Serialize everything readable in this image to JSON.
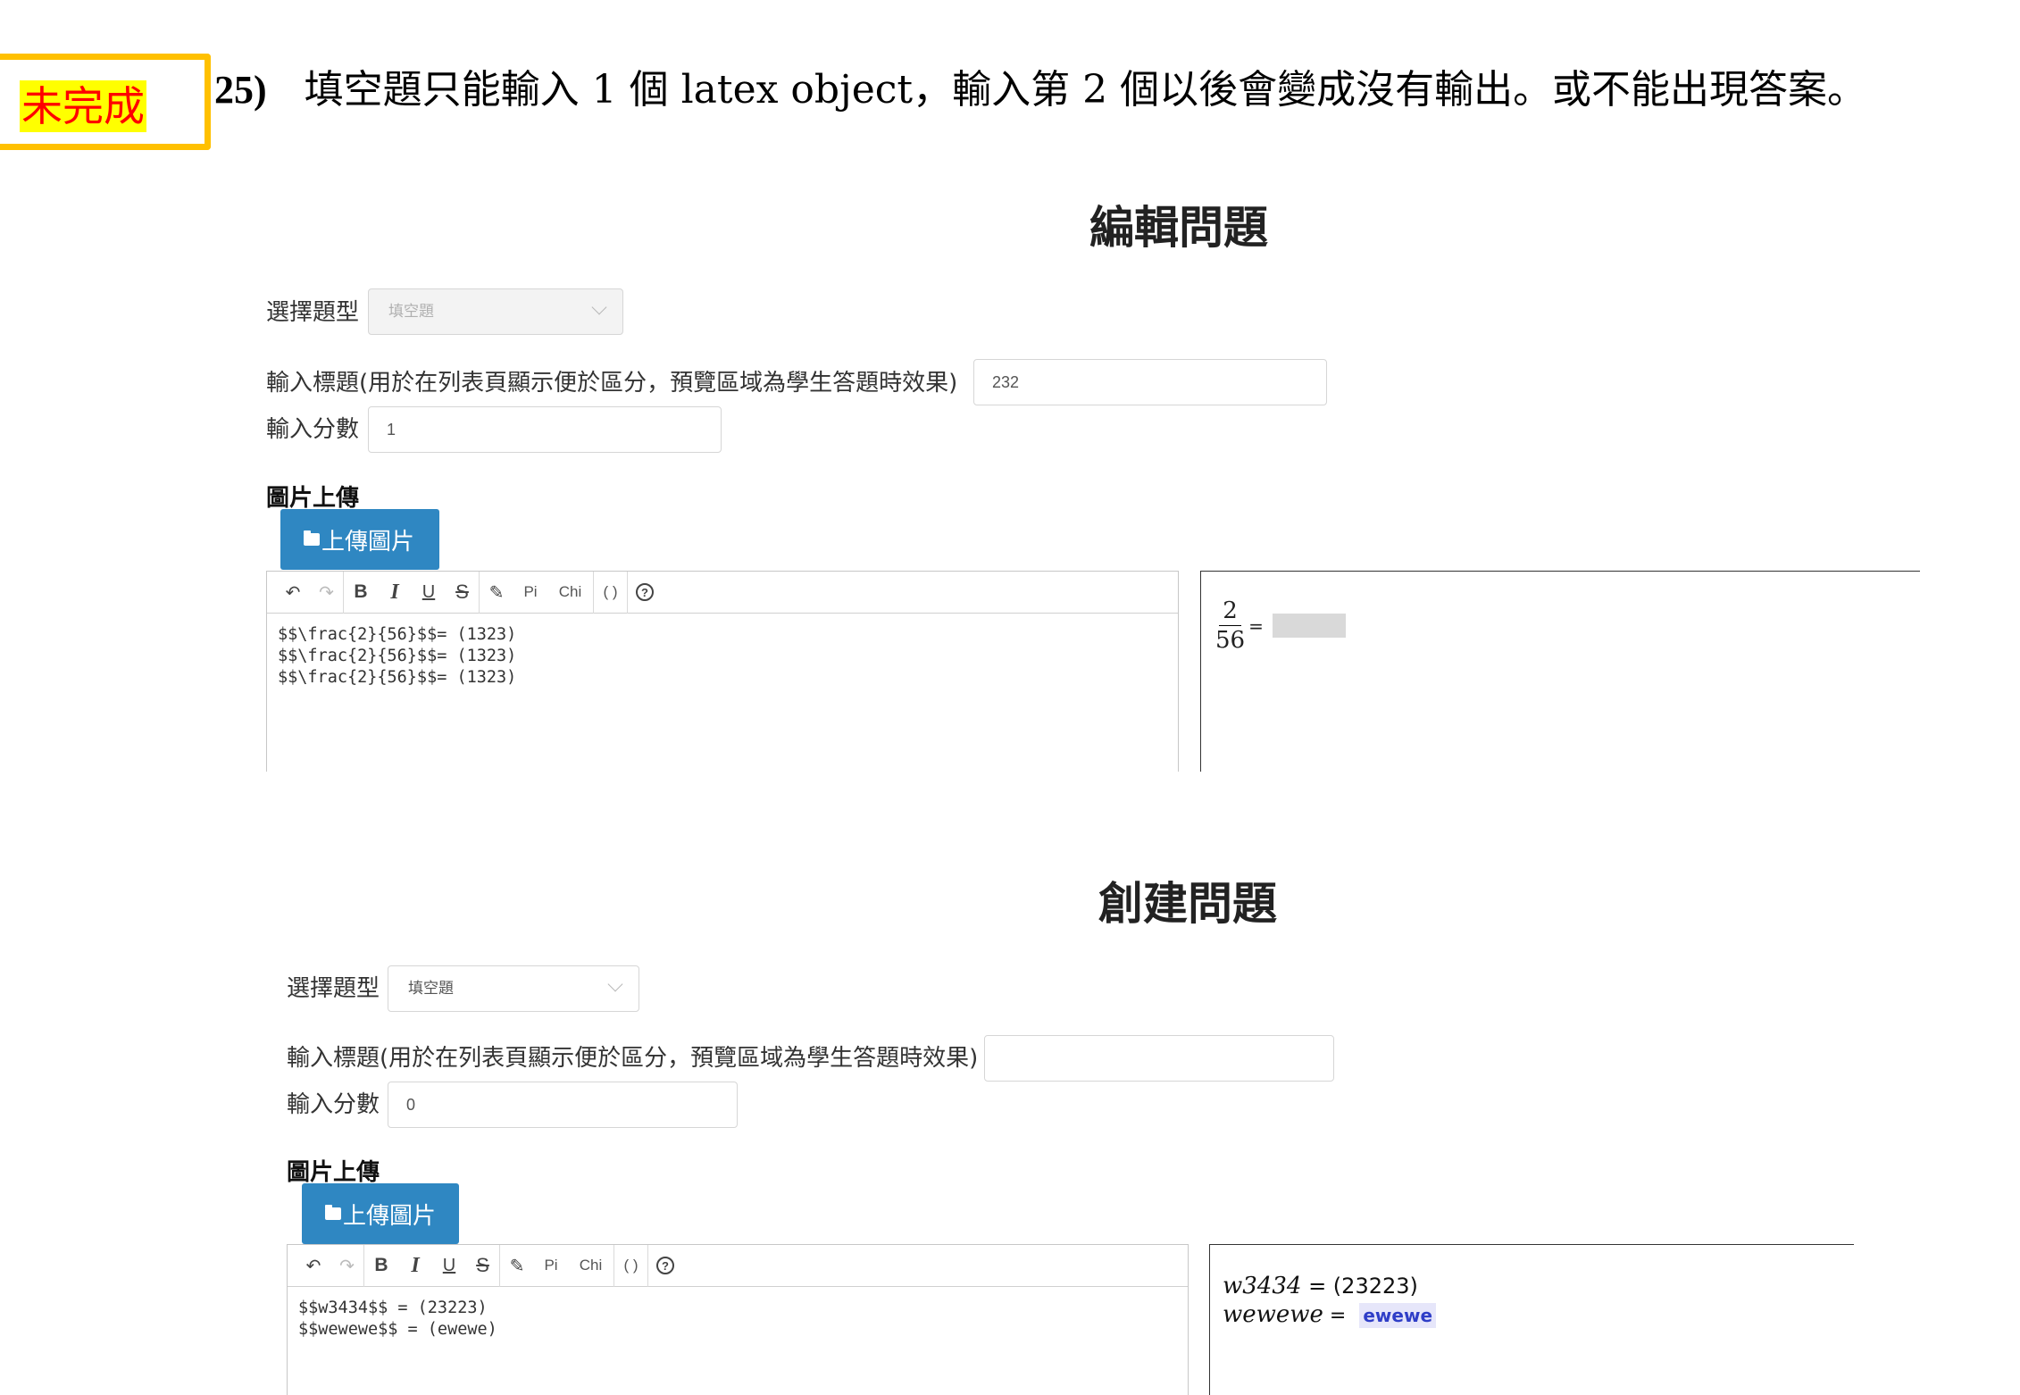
{
  "annotation": {
    "status": "未完成",
    "issue_number": "25)",
    "issue_text": "填空題只能輸入 1 個 latex object，輸入第 2 個以後會變成沒有輸出。或不能出現答案。"
  },
  "panels": [
    {
      "title": "編輯問題",
      "question_type_label": "選擇題型",
      "question_type_value": "填空題",
      "question_type_disabled": true,
      "title_label": "輸入標題(用於在列表頁顯示便於區分，預覽區域為學生答題時效果)",
      "title_value": "232",
      "score_label": "輸入分數",
      "score_value": "1",
      "image_section_label": "圖片上傳",
      "upload_button": "上傳圖片",
      "toolbar": {
        "pi": "Pi",
        "chi": "Chi",
        "parens": "( )"
      },
      "editor_lines": [
        "$$\\frac{2}{56}$$= (1323)",
        "$$\\frac{2}{56}$$= (1323)",
        "$$\\frac{2}{56}$$= (1323)"
      ],
      "preview": {
        "numerator": "2",
        "denominator": "56",
        "equals": "="
      }
    },
    {
      "title": "創建問題",
      "question_type_label": "選擇題型",
      "question_type_value": "填空題",
      "question_type_disabled": false,
      "title_label": "輸入標題(用於在列表頁顯示便於區分，預覽區域為學生答題時效果)",
      "title_value": "",
      "score_label": "輸入分數",
      "score_value": "0",
      "image_section_label": "圖片上傳",
      "upload_button": "上傳圖片",
      "toolbar": {
        "pi": "Pi",
        "chi": "Chi",
        "parens": "( )"
      },
      "editor_lines": [
        "$$w3434$$ = (23223)",
        "$$wewewe$$ = (ewewe)"
      ],
      "preview": {
        "line1_var": "w3434",
        "line1_rest": " = (23223)",
        "line2_var": "wewewe",
        "line2_eq": " = ",
        "line2_answer": "ewewe"
      }
    }
  ]
}
